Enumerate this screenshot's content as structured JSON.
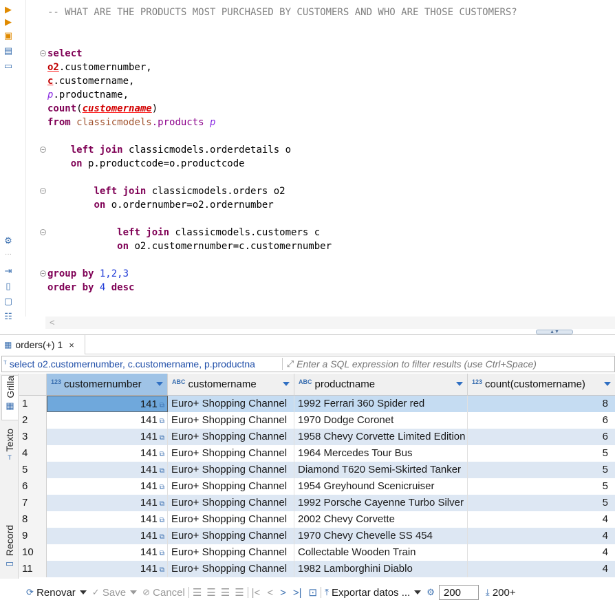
{
  "editor": {
    "comment": "-- WHAT ARE THE PRODUCTS MOST PURCHASED BY CUSTOMERS AND WHO ARE THOSE CUSTOMERS?",
    "kw_select": "select",
    "alias_o2": "o2",
    "col_customernumber": ".customernumber,",
    "alias_c": "c",
    "col_customername": ".customername,",
    "alias_p": "p",
    "col_productname": ".productname,",
    "kw_count": "count",
    "paren_open": "(",
    "count_arg": "customername",
    "paren_close": ")",
    "kw_from": "from",
    "schema": "classicmodels",
    "table_products": ".products",
    "alias_p2": " p",
    "kw_left_join": "left join",
    "join1_table": " classicmodels.orderdetails o",
    "kw_on": "on",
    "join1_on": " p.productcode=o.productcode",
    "join2_table": " classicmodels.orders o2",
    "join2_on": " o.ordernumber=o2.ordernumber",
    "join3_table": " classicmodels.customers c",
    "join3_on": " o2.customernumber=c.customernumber",
    "kw_group_by": "group by",
    "group_cols": " 1,2,3",
    "kw_order_by": "order by",
    "order_col": " 4 ",
    "kw_desc": "desc",
    "scroll_left_arrow": "<"
  },
  "results": {
    "tab_label": "orders(+) 1",
    "tab_close": "×",
    "filter_query": "select o2.customernumber, c.customername, p.productna",
    "filter_placeholder": "Enter a SQL expression to filter results (use Ctrl+Space)",
    "side_tabs": {
      "grid": "Grilla",
      "text": "Texto",
      "record": "Record"
    },
    "columns": [
      {
        "type": "123",
        "name": "customernumber"
      },
      {
        "type": "ABC",
        "name": "customername"
      },
      {
        "type": "ABC",
        "name": "productname"
      },
      {
        "type": "123",
        "name": "count(customername)"
      }
    ],
    "rows": [
      {
        "n": "1",
        "customernumber": "141",
        "customername": "Euro+ Shopping Channel",
        "productname": "1992 Ferrari 360 Spider red",
        "count": "8"
      },
      {
        "n": "2",
        "customernumber": "141",
        "customername": "Euro+ Shopping Channel",
        "productname": "1970 Dodge Coronet",
        "count": "6"
      },
      {
        "n": "3",
        "customernumber": "141",
        "customername": "Euro+ Shopping Channel",
        "productname": "1958 Chevy Corvette Limited Edition",
        "count": "6"
      },
      {
        "n": "4",
        "customernumber": "141",
        "customername": "Euro+ Shopping Channel",
        "productname": "1964 Mercedes Tour Bus",
        "count": "5"
      },
      {
        "n": "5",
        "customernumber": "141",
        "customername": "Euro+ Shopping Channel",
        "productname": "Diamond T620 Semi-Skirted Tanker",
        "count": "5"
      },
      {
        "n": "6",
        "customernumber": "141",
        "customername": "Euro+ Shopping Channel",
        "productname": "1954 Greyhound Scenicruiser",
        "count": "5"
      },
      {
        "n": "7",
        "customernumber": "141",
        "customername": "Euro+ Shopping Channel",
        "productname": "1992 Porsche Cayenne Turbo Silver",
        "count": "5"
      },
      {
        "n": "8",
        "customernumber": "141",
        "customername": "Euro+ Shopping Channel",
        "productname": "2002 Chevy Corvette",
        "count": "4"
      },
      {
        "n": "9",
        "customernumber": "141",
        "customername": "Euro+ Shopping Channel",
        "productname": "1970 Chevy Chevelle SS 454",
        "count": "4"
      },
      {
        "n": "10",
        "customernumber": "141",
        "customername": "Euro+ Shopping Channel",
        "productname": "Collectable Wooden Train",
        "count": "4"
      },
      {
        "n": "11",
        "customernumber": "141",
        "customername": "Euro+ Shopping Channel",
        "productname": "1982 Lamborghini Diablo",
        "count": "4"
      }
    ],
    "toolbar": {
      "refresh": "Renovar",
      "save": "Save",
      "cancel": "Cancel",
      "export": "Exportar datos ...",
      "fetch_size": "200",
      "row_count": "200+"
    }
  },
  "colors": {
    "keyword": "#7f0055",
    "selected_row": "#c5dcf2",
    "alt_row": "#dde7f3",
    "header_selected": "#9fc3e6",
    "accent": "#3a6fb0"
  }
}
